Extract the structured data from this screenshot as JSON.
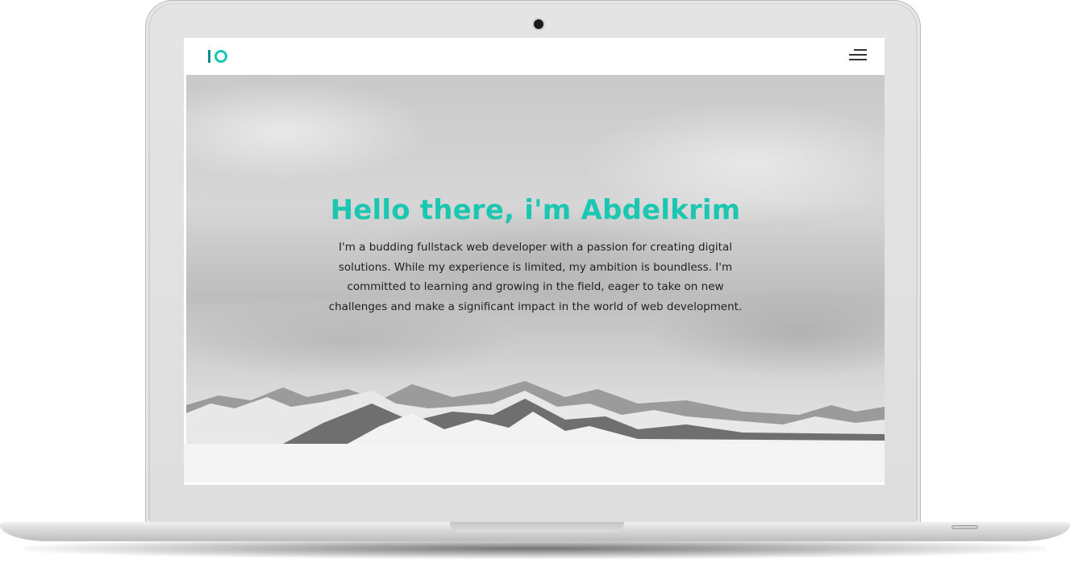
{
  "device": {
    "type": "laptop-mockup"
  },
  "navbar": {
    "logo_icon": "io-logo-icon",
    "menu_icon": "hamburger-menu-icon"
  },
  "hero": {
    "title": "Hello there, i'm Abdelkrim",
    "text": "I'm a budding fullstack web developer with a passion for creating digital solutions. While my experience is limited, my ambition is boundless. I'm committed to learning and growing in the field, eager to take on new challenges and make a significant impact in the world of web development.",
    "background": "mountains-grayscale-image"
  },
  "colors": {
    "accent": "#1cc7b1",
    "logo_dark": "#0f8a8a",
    "text": "#1f1f1f"
  }
}
